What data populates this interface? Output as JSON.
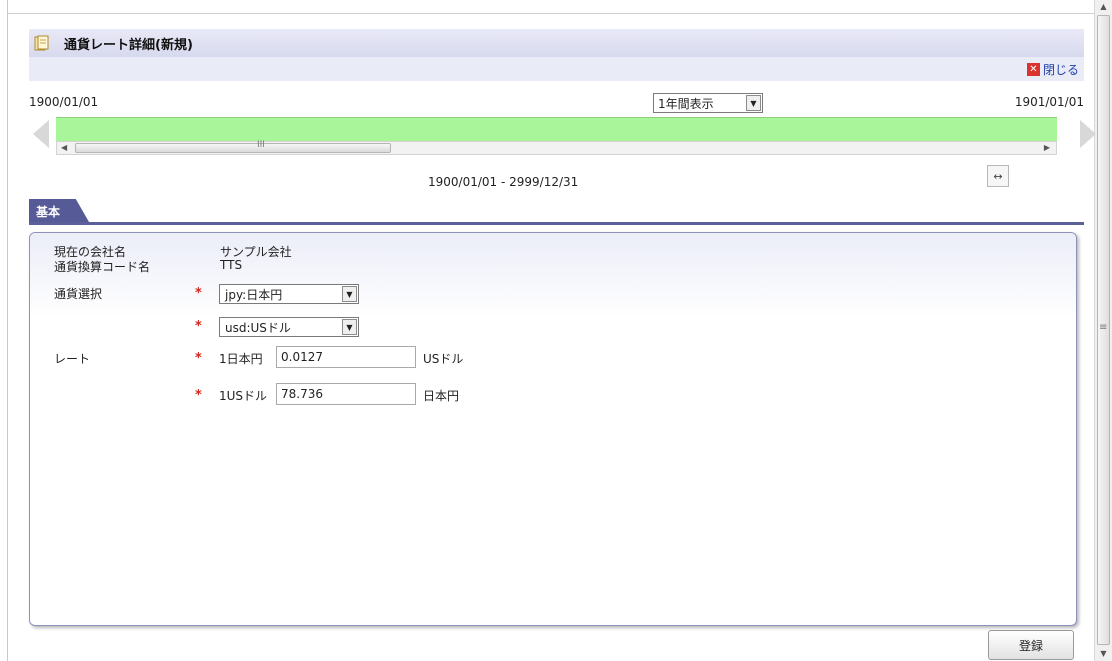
{
  "title": "通貨レート詳細(新規)",
  "close_label": "閉じる",
  "timeline": {
    "start_date": "1900/01/01",
    "end_date": "1901/01/01",
    "range_select": "1年間表示",
    "period": "1900/01/01 - 2999/12/31",
    "scroll_grip": "III"
  },
  "tab_label": "基本",
  "form": {
    "company_label": "現在の会社名",
    "company_value": "サンプル会社",
    "conversion_label": "通貨換算コード名",
    "conversion_value": "TTS",
    "currency_label": "通貨選択",
    "currency_from": "jpy:日本円",
    "currency_to": "usd:USドル",
    "rate_label": "レート",
    "required_mark": "*",
    "rate1_prefix": "1日本円",
    "rate1_value": "0.0127",
    "rate1_unit": "USドル",
    "rate2_prefix": "1USドル",
    "rate2_value": "78.736",
    "rate2_unit": "日本円"
  },
  "register_label": "登録",
  "colors": {
    "accent": "#565b97",
    "timeline_bar": "#a8f59a",
    "required": "#d4261a"
  },
  "icons": {
    "title": "folder-doc-icon",
    "close": "close-x-icon",
    "expand": "expand-horizontal-icon"
  }
}
